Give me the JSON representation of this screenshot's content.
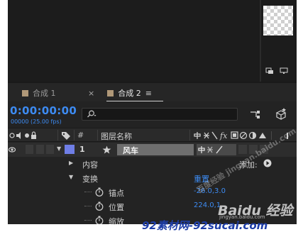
{
  "tabs": [
    {
      "label": "合成 1",
      "swatch": "#b09878"
    },
    {
      "label": "合成 2",
      "swatch": "#b09878",
      "active": true
    }
  ],
  "tab_close": "×",
  "tab_menu": "≡",
  "timecode": "0:00:00:00",
  "fps": "00000 (25.00 fps)",
  "search": {
    "placeholder": ""
  },
  "columns": {
    "num": "#",
    "layer_name": "图层名称"
  },
  "layer": {
    "number": "1",
    "name": "风车",
    "color": "#6f7ee6"
  },
  "rows": {
    "content": "内容",
    "add_label": "添加:",
    "transform": "变换",
    "reset": "重置",
    "anchor_label": "锚点",
    "anchor_value": "-26.0,3.0",
    "position_label": "位置",
    "position_value": "224.0,1",
    "scale_label": "缩放"
  },
  "watermark": {
    "brand": "Baidu 经验",
    "sub": "jingyan.baidu.com",
    "diag": "百度经验 jingyan.baidu.com"
  },
  "site_url": "92素材网-92sucai.com",
  "colors": {
    "accent": "#3d8bf2",
    "layer": "#6f7ee6"
  }
}
